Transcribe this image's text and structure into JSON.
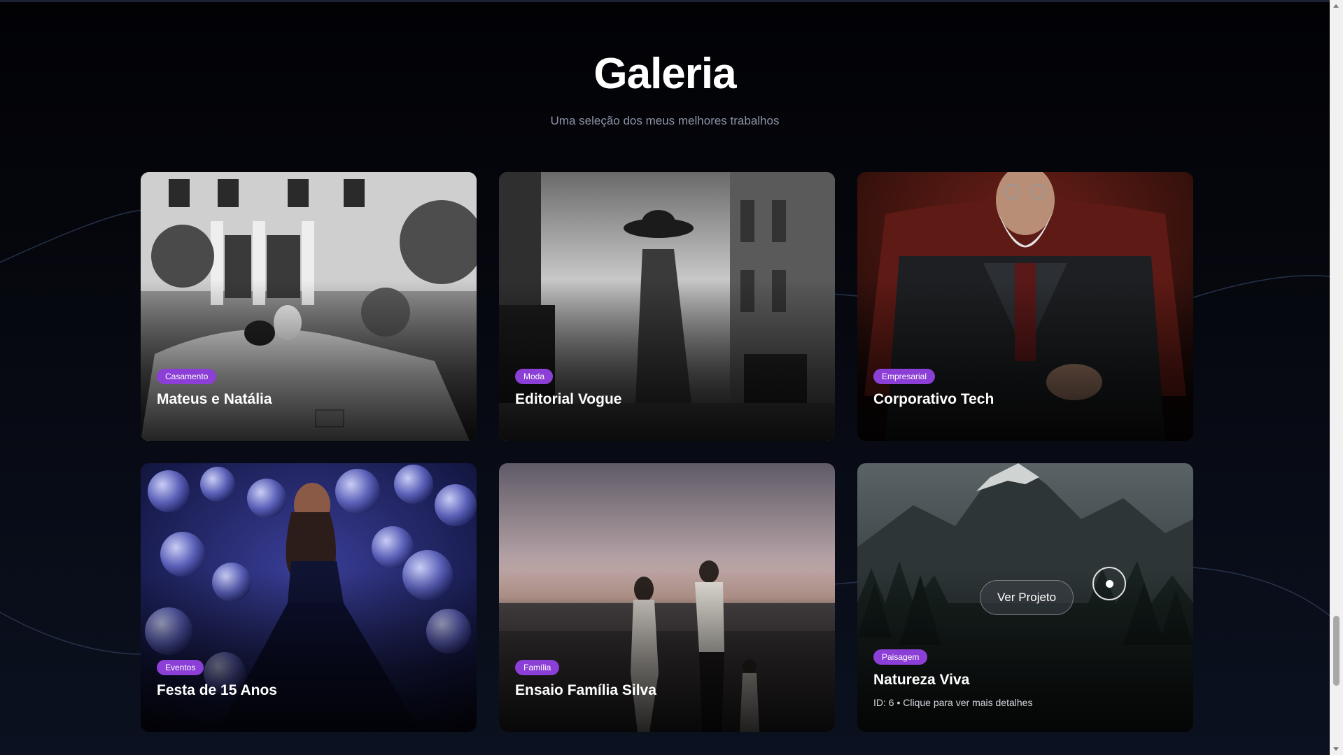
{
  "gallery": {
    "title": "Galeria",
    "subtitle": "Uma seleção dos meus melhores trabalhos"
  },
  "cards": [
    {
      "category": "Casamento",
      "title": "Mateus e Natália",
      "photo_icon": "wedding-car-photo"
    },
    {
      "category": "Moda",
      "title": "Editorial Vogue",
      "photo_icon": "fashion-street-photo"
    },
    {
      "category": "Empresarial",
      "title": "Corporativo Tech",
      "photo_icon": "portrait-armchair-photo"
    },
    {
      "category": "Eventos",
      "title": "Festa de 15 Anos",
      "photo_icon": "disco-balls-photo"
    },
    {
      "category": "Família",
      "title": "Ensaio Família Silva",
      "photo_icon": "beach-sunset-photo"
    },
    {
      "category": "Paisagem",
      "title": "Natureza Viva",
      "meta": "ID: 6 • Clique para ver mais detalhes",
      "button_label": "Ver Projeto",
      "photo_icon": "mountain-forest-photo"
    }
  ],
  "colors": {
    "background": "#05060b",
    "tag": "#8b3fd6",
    "text": "#ffffff",
    "subtitle": "#8d93a6"
  }
}
